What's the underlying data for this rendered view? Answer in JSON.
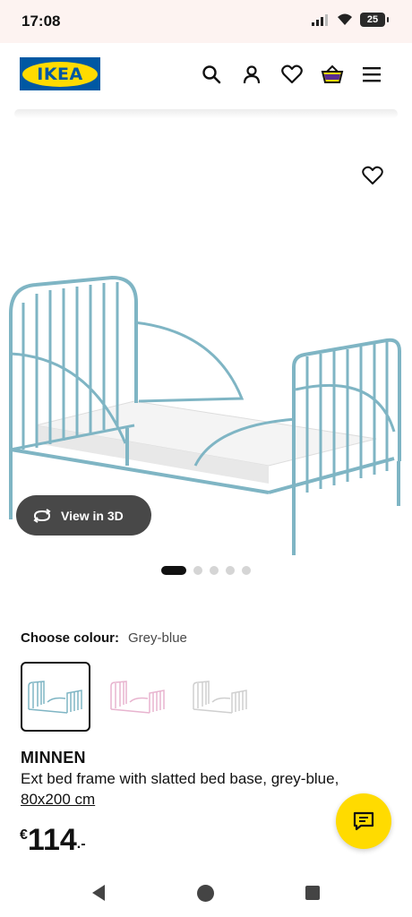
{
  "status_bar": {
    "time": "17:08",
    "battery": "25"
  },
  "header": {
    "logo_text": "IKEA",
    "icons": [
      "search-icon",
      "profile-icon",
      "heart-icon",
      "basket-icon",
      "menu-icon"
    ]
  },
  "gallery": {
    "view_3d_label": "View in 3D",
    "image_count": 5,
    "active_index": 0
  },
  "colour": {
    "label": "Choose colour:",
    "value": "Grey-blue",
    "options": [
      "grey-blue",
      "pink",
      "white"
    ]
  },
  "product": {
    "name": "MINNEN",
    "description": "Ext bed frame with slatted bed base, grey-blue,",
    "size": "80x200 cm",
    "price_currency": "€",
    "price_integer": "114",
    "price_decimal": ".-"
  },
  "colors": {
    "accent_yellow": "#ffdb00",
    "ikea_blue": "#0058a3",
    "bed_grey_blue": "#7fb5c4"
  }
}
